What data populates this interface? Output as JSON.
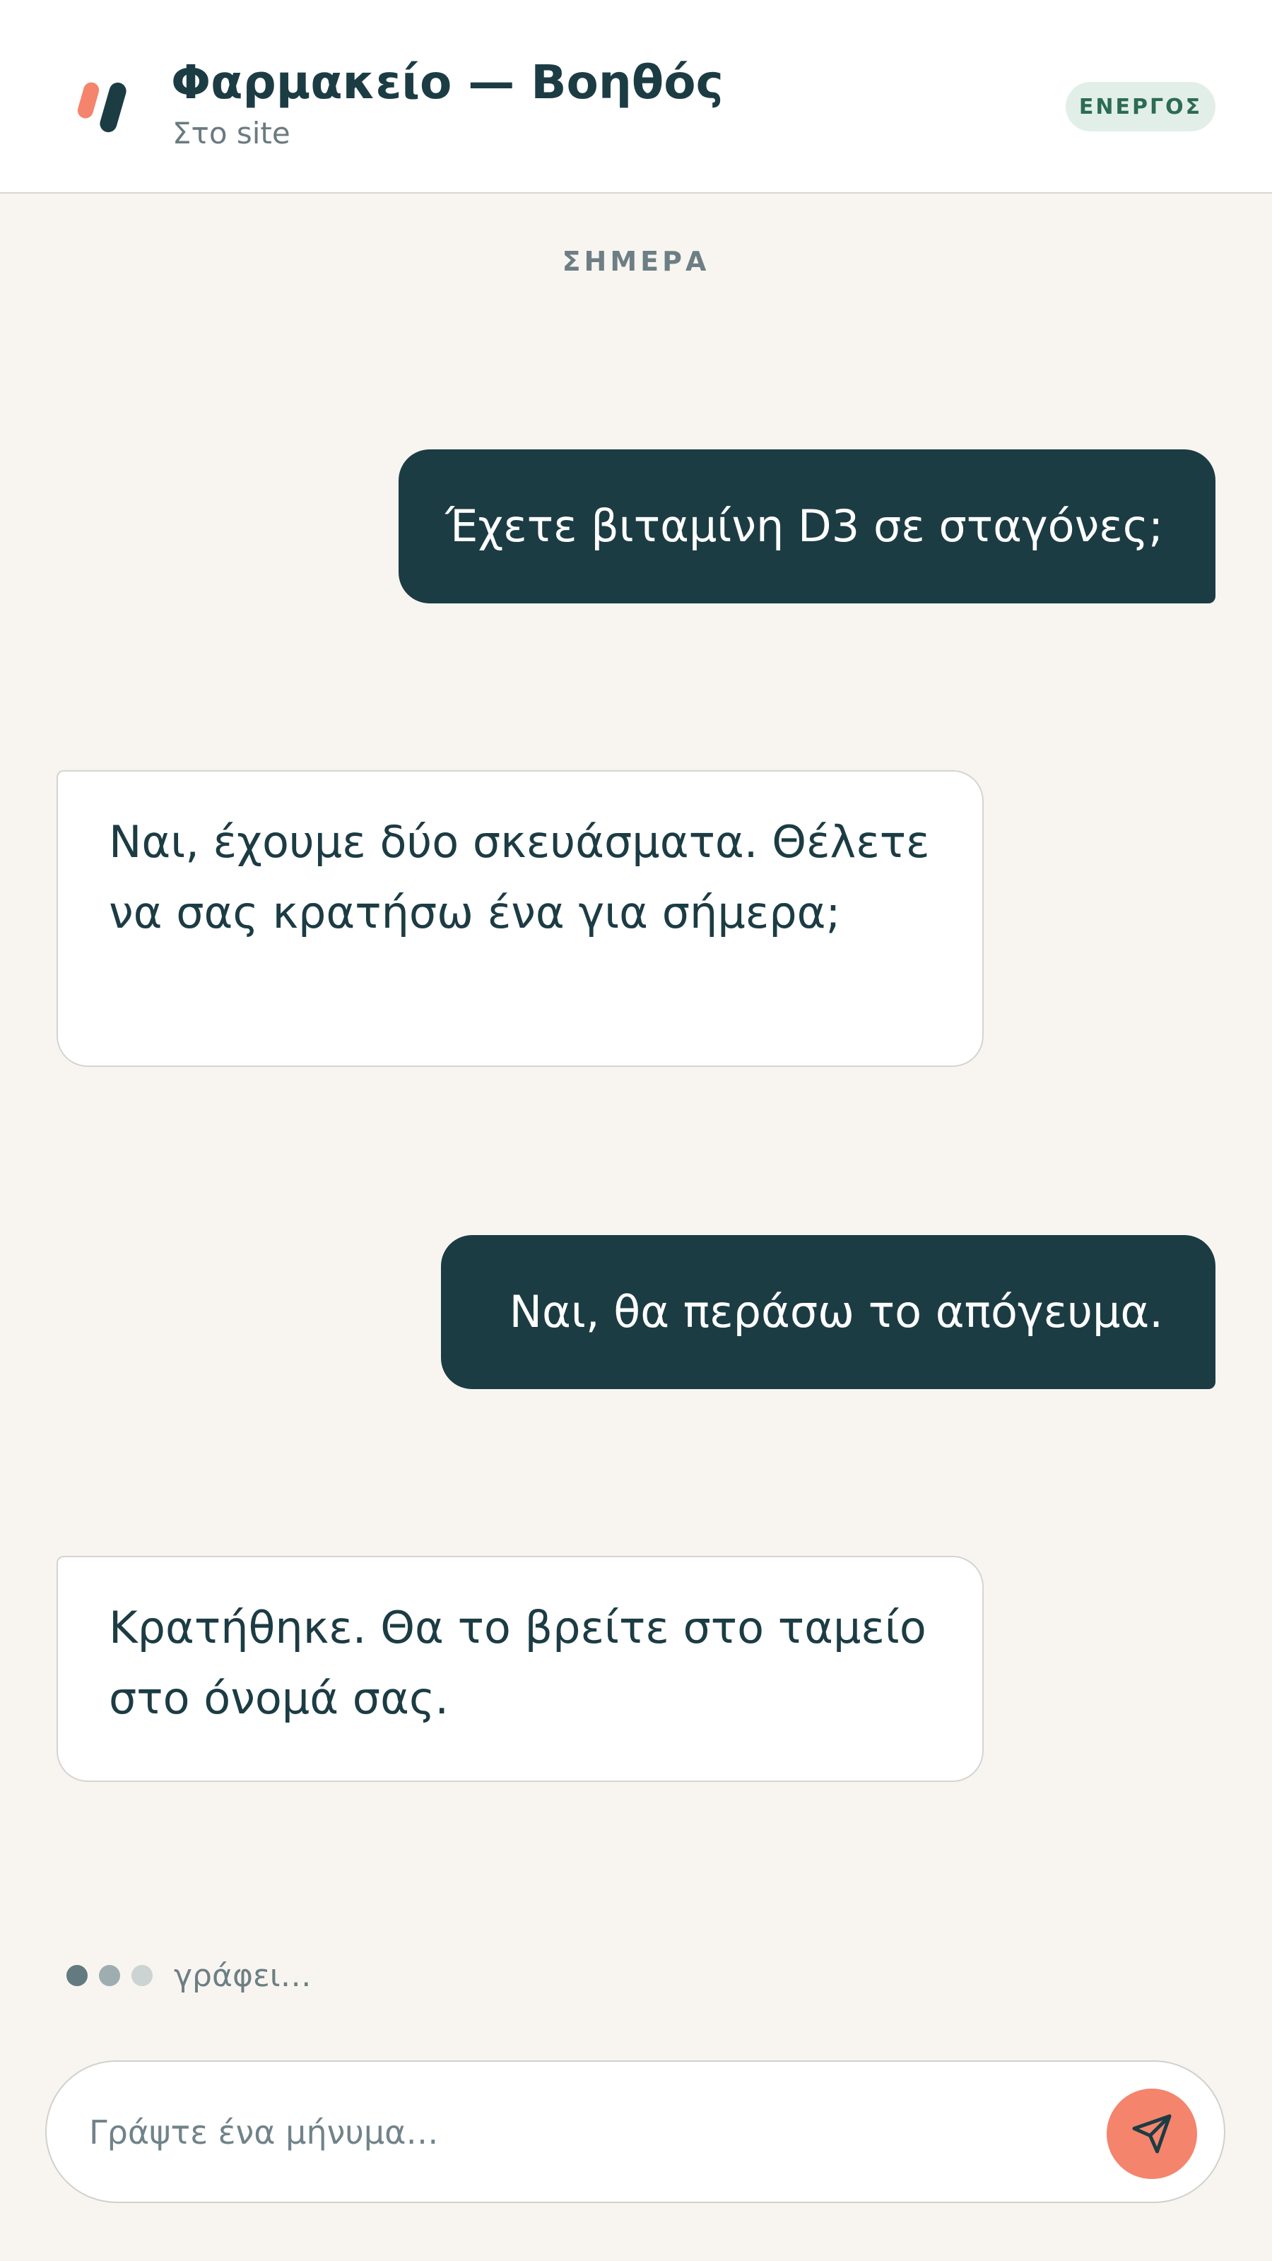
{
  "header": {
    "title": "Φαρμακείο — Βοηθός",
    "subtitle": "Στο site",
    "status": "ΕΝΕΡΓΟΣ"
  },
  "date_divider": "ΣΗΜΕΡΑ",
  "messages": [
    {
      "sender": "user",
      "text": "Έχετε βιταμίνη D3 σε σταγόνες;"
    },
    {
      "sender": "bot",
      "text": "Ναι, έχουμε δύο σκευάσματα. Θέλετε να σας κρατήσω ένα για σήμερα;"
    },
    {
      "sender": "user",
      "text": "Ναι, θα περάσω το απόγευμα."
    },
    {
      "sender": "bot",
      "text": "Κρατήθηκε. Θα το βρείτε στο ταμείο στο όνομά σας."
    }
  ],
  "typing": {
    "label": "γράφει…"
  },
  "composer": {
    "placeholder": "Γράψτε ένα μήνυμα…",
    "send_icon": "send-icon"
  },
  "colors": {
    "primary": "#1c3c44",
    "accent": "#f4846c",
    "background": "#f8f5f0",
    "status_bg": "#e2efe8",
    "status_fg": "#2c6b55"
  }
}
